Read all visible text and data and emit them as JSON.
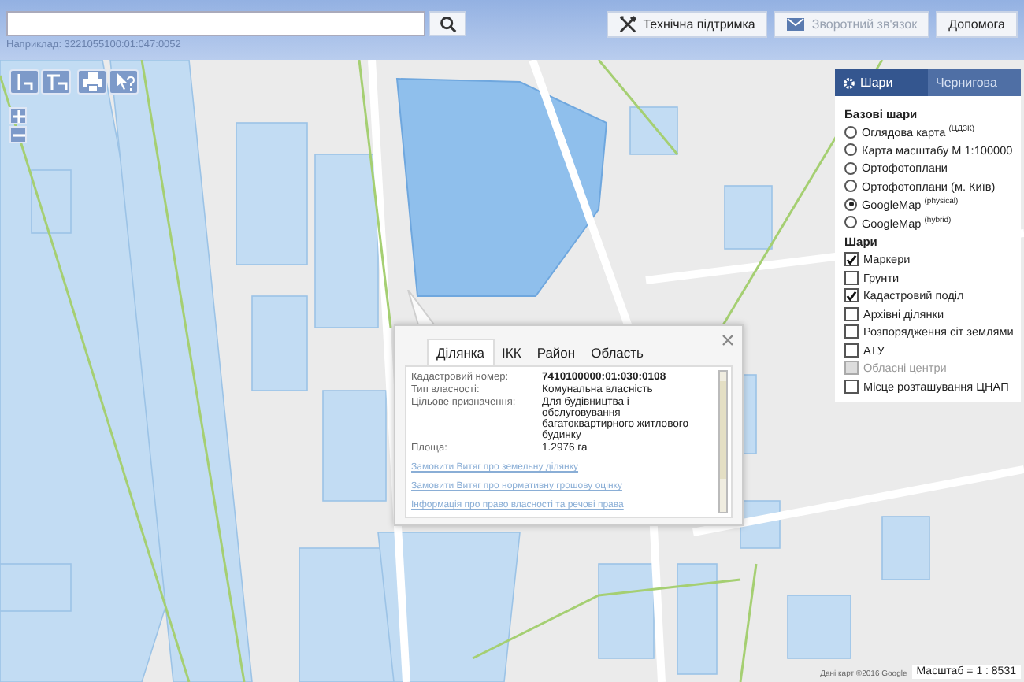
{
  "search": {
    "hint": "Наприклад: 3221055100:01:047:0052"
  },
  "header_buttons": [
    {
      "label": "Технічна підтримка",
      "kind": "tools",
      "disabled": false
    },
    {
      "label": "Зворотний зв'язок",
      "kind": "mail",
      "disabled": true
    },
    {
      "label": "Допомога",
      "kind": "plain",
      "disabled": false
    }
  ],
  "layers_panel": {
    "tabs": [
      {
        "label": "Шари",
        "selected": true
      },
      {
        "label": "Чернигова",
        "selected": false
      }
    ],
    "base_title": "Базові шари",
    "base_layers": [
      {
        "label": "Оглядова карта $^{(ЦДЗК)}$",
        "selected": false
      },
      {
        "label": "Карта масштабу М 1:100000",
        "selected": false
      },
      {
        "label": "Ортофотоплани",
        "selected": false
      },
      {
        "label": "Ортофотоплани (м. Київ)",
        "selected": false
      },
      {
        "label": "GoogleMap $^{(physical)}$",
        "selected": true
      },
      {
        "label": "GoogleMap $^{(hybrid)}$",
        "selected": false
      }
    ],
    "layers_title": "Шари",
    "layers": [
      {
        "label": "Маркери",
        "checked": true,
        "disabled": false
      },
      {
        "label": "Грунти",
        "checked": false,
        "disabled": false
      },
      {
        "label": "Кадастровий поділ",
        "checked": true,
        "disabled": false
      },
      {
        "label": "Архівні ділянки",
        "checked": false,
        "disabled": false
      },
      {
        "label": "Розпорядження сіт землями",
        "checked": false,
        "disabled": false
      },
      {
        "label": "АТУ",
        "checked": false,
        "disabled": false
      },
      {
        "label": "Обласні центри",
        "checked": false,
        "disabled": true
      },
      {
        "label": "Місце розташування ЦНАП",
        "checked": false,
        "disabled": false
      }
    ]
  },
  "popup": {
    "tabs": [
      {
        "label": "Ділянка",
        "selected": true
      },
      {
        "label": "ІКК",
        "selected": false
      },
      {
        "label": "Район",
        "selected": false
      },
      {
        "label": "Область",
        "selected": false
      }
    ],
    "fields": [
      {
        "label": "Кадастровий номер:",
        "value": "7410100000:01:030:0108",
        "bold": true
      },
      {
        "label": "Тип власності:",
        "value": "Комунальна власність",
        "bold": false
      },
      {
        "label": "Цільове призначення:",
        "value": "Для будівництва і обслуговування багатоквартирного житлового будинку",
        "bold": false
      },
      {
        "label": "Площа:",
        "value": "1.2976 га",
        "bold": false
      }
    ],
    "links": [
      "Замовити Витяг про земельну ділянку",
      "Замовити Витяг про нормативну грошову оцінку",
      "Інформація про право власності та речові права"
    ]
  },
  "attribution": "Дані карт ©2016 Google",
  "scale": "Масштаб = 1 : 8531"
}
